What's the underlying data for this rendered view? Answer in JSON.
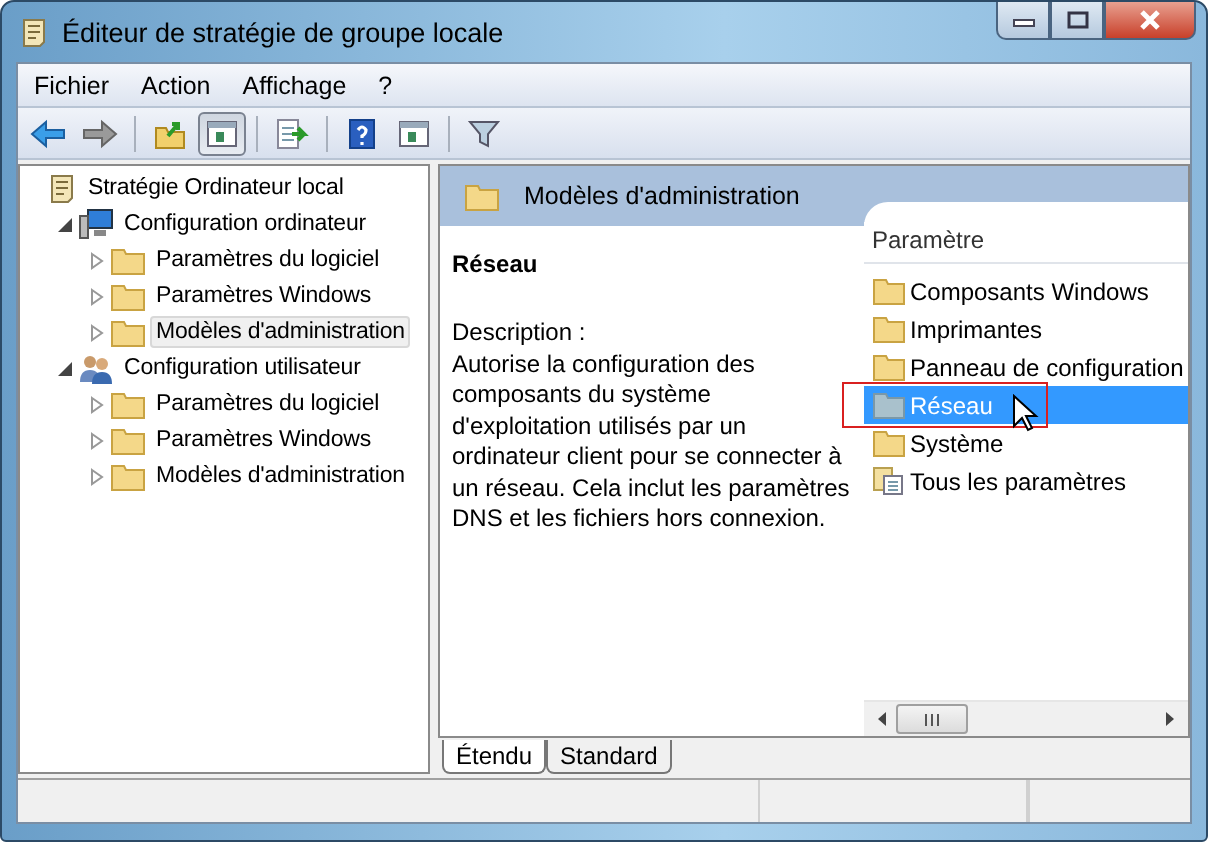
{
  "window": {
    "title": "Éditeur de stratégie de groupe locale"
  },
  "menu": [
    "Fichier",
    "Action",
    "Affichage",
    "?"
  ],
  "toolbar": [
    {
      "kind": "back",
      "pressed": false
    },
    {
      "kind": "forward",
      "pressed": false
    },
    {
      "kind": "sep"
    },
    {
      "kind": "up",
      "pressed": false
    },
    {
      "kind": "tree",
      "pressed": true
    },
    {
      "kind": "sep"
    },
    {
      "kind": "export",
      "pressed": false
    },
    {
      "kind": "sep"
    },
    {
      "kind": "help",
      "pressed": false
    },
    {
      "kind": "pane",
      "pressed": false
    },
    {
      "kind": "sep"
    },
    {
      "kind": "filter",
      "pressed": false
    }
  ],
  "tree": {
    "label": "Stratégie Ordinateur local",
    "kind": "policy",
    "selected": false,
    "children": [
      {
        "label": "Configuration ordinateur",
        "kind": "computer",
        "expanded": true,
        "selected": false,
        "children": [
          {
            "label": "Paramètres du logiciel",
            "kind": "folder",
            "expanded": false,
            "selected": false
          },
          {
            "label": "Paramètres Windows",
            "kind": "folder",
            "expanded": false,
            "selected": false
          },
          {
            "label": "Modèles d'administration",
            "kind": "folder",
            "expanded": false,
            "selected": true
          }
        ]
      },
      {
        "label": "Configuration utilisateur",
        "kind": "user",
        "expanded": true,
        "selected": false,
        "children": [
          {
            "label": "Paramètres du logiciel",
            "kind": "folder",
            "expanded": false,
            "selected": false
          },
          {
            "label": "Paramètres Windows",
            "kind": "folder",
            "expanded": false,
            "selected": false
          },
          {
            "label": "Modèles d'administration",
            "kind": "folder",
            "expanded": false,
            "selected": false
          }
        ]
      }
    ]
  },
  "content": {
    "header": "Modèles d'administration",
    "description": {
      "title": "Réseau",
      "label": "Description :",
      "text": "Autorise la configuration des composants du système d'exploitation utilisés par un ordinateur client pour se connecter à un réseau. Cela inclut les paramètres DNS et les fichiers hors connexion."
    },
    "list": {
      "column": "Paramètre",
      "items": [
        {
          "label": "Composants Windows",
          "kind": "folder",
          "selected": false,
          "marked": false
        },
        {
          "label": "Imprimantes",
          "kind": "folder",
          "selected": false,
          "marked": false
        },
        {
          "label": "Panneau de configuration",
          "kind": "folder",
          "selected": false,
          "marked": false
        },
        {
          "label": "Réseau",
          "kind": "folder",
          "selected": true,
          "marked": true
        },
        {
          "label": "Système",
          "kind": "folder",
          "selected": false,
          "marked": false
        },
        {
          "label": "Tous les paramètres",
          "kind": "all",
          "selected": false,
          "marked": false
        }
      ]
    },
    "tabs": [
      {
        "label": "Étendu",
        "selected": true
      },
      {
        "label": "Standard",
        "selected": false
      }
    ]
  }
}
